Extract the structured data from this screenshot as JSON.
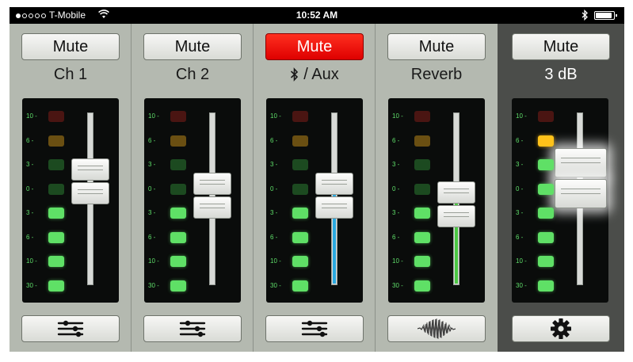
{
  "status_bar": {
    "carrier": "T-Mobile",
    "time": "10:52 AM",
    "signal_dots_filled": 1,
    "signal_dots_total": 5,
    "battery_level": 0.9
  },
  "meter_scale": [
    "10",
    "6",
    "3",
    "0",
    "3",
    "6",
    "10",
    "30"
  ],
  "channels": [
    {
      "mute_label": "Mute",
      "mute_active": false,
      "label": "Ch 1",
      "lit_leds": 4,
      "fader_position": 0.6,
      "fill_color": null,
      "bottom_icon": "sliders-icon"
    },
    {
      "mute_label": "Mute",
      "mute_active": false,
      "label": "Ch 2",
      "lit_leds": 4,
      "fader_position": 0.52,
      "fill_color": null,
      "bottom_icon": "sliders-icon"
    },
    {
      "mute_label": "Mute",
      "mute_active": true,
      "label": "/ Aux",
      "label_icon": "bluetooth-icon",
      "lit_leds": 4,
      "fader_position": 0.52,
      "fill_color": "#2aa9e0",
      "bottom_icon": "sliders-icon"
    },
    {
      "mute_label": "Mute",
      "mute_active": false,
      "label": "Reverb",
      "lit_leds": 4,
      "fader_position": 0.47,
      "fill_color": "#4cc744",
      "bottom_icon": "reverb-waveform-icon"
    },
    {
      "mute_label": "Mute",
      "mute_active": false,
      "label": "3 dB",
      "lit_leds": 7,
      "fader_position": 0.62,
      "fill_color": null,
      "bottom_icon": "gear-icon",
      "selected": true
    }
  ],
  "colors": {
    "mute_active": "#e60000",
    "led_on": "#5fe066",
    "led_yellow": "#ffc21a",
    "led_red_off": "#4a1512",
    "aux_fill": "#2aa9e0",
    "reverb_fill": "#4cc744",
    "master_bg": "#4b4d4a"
  }
}
